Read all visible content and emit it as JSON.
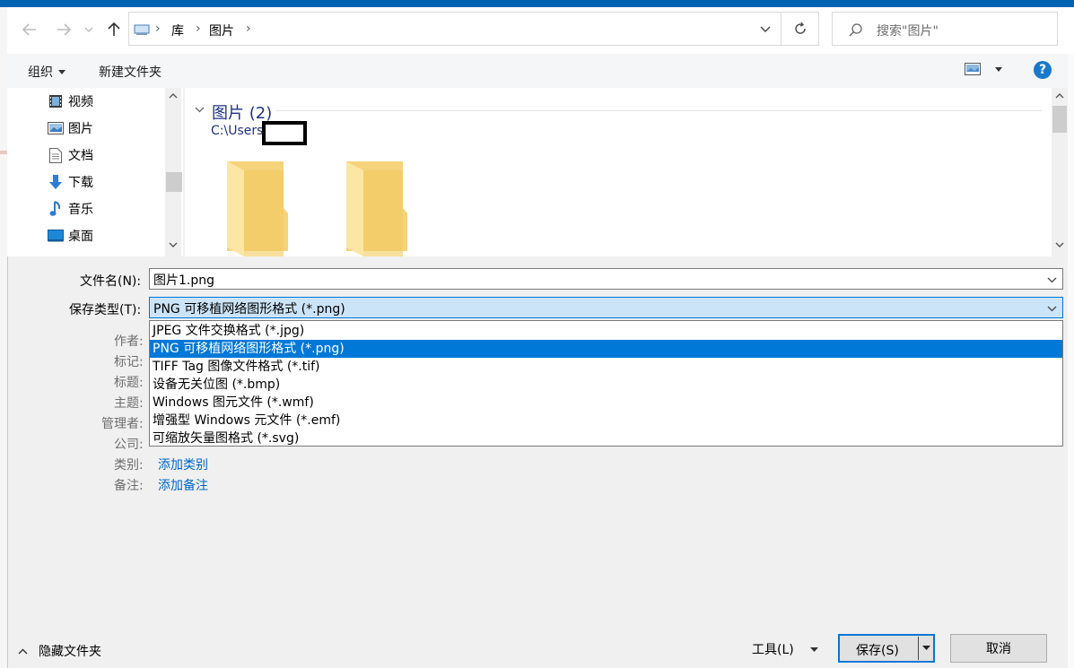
{
  "nav": {
    "breadcrumbs": [
      "库",
      "图片"
    ],
    "search_placeholder": "搜索\"图片\""
  },
  "toolbar": {
    "organize": "组织",
    "new_folder": "新建文件夹",
    "help": "?"
  },
  "sidebar": {
    "items": [
      {
        "label": "视频",
        "icon": "video-icon"
      },
      {
        "label": "图片",
        "icon": "picture-icon"
      },
      {
        "label": "文档",
        "icon": "document-icon"
      },
      {
        "label": "下载",
        "icon": "download-icon"
      },
      {
        "label": "音乐",
        "icon": "music-icon"
      },
      {
        "label": "桌面",
        "icon": "desktop-icon"
      }
    ]
  },
  "content": {
    "group_title": "图片 (2)",
    "group_path": "C:\\Users"
  },
  "form": {
    "filename_label": "文件名(N):",
    "filename_value": "图片1.png",
    "filetype_label": "保存类型(T):",
    "filetype_value": "PNG 可移植网络图形格式 (*.png)",
    "filetype_options": [
      "JPEG 文件交换格式 (*.jpg)",
      "PNG 可移植网络图形格式 (*.png)",
      "TIFF Tag 图像文件格式 (*.tif)",
      "设备无关位图 (*.bmp)",
      "Windows 图元文件 (*.wmf)",
      "增强型 Windows 元文件 (*.emf)",
      "可缩放矢量图格式 (*.svg)"
    ],
    "selected_option_index": 1
  },
  "meta": {
    "author": "作者:",
    "tags": "标记:",
    "title": "标题:",
    "subject": "主题:",
    "manager": "管理者:",
    "company": "公司:",
    "category": "类别:",
    "category_link": "添加类别",
    "comments": "备注:",
    "comments_link": "添加备注"
  },
  "footer": {
    "hide_folders": "隐藏文件夹",
    "tools": "工具(L)",
    "save": "保存(S)",
    "cancel": "取消"
  },
  "colors": {
    "accent": "#0078d7",
    "link": "#0066cc",
    "group_title": "#1e3287"
  }
}
